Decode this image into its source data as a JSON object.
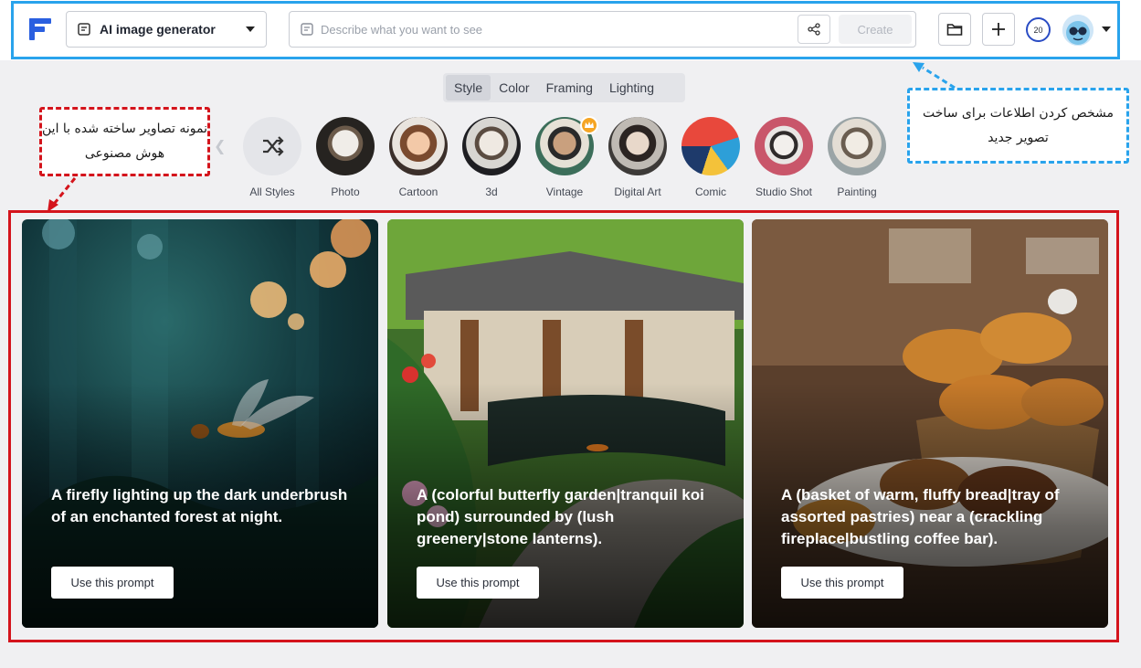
{
  "header": {
    "generator_label": "AI image generator",
    "prompt_placeholder": "Describe what you want to see",
    "create_label": "Create",
    "credits": "20"
  },
  "tabs": [
    {
      "label": "Style",
      "active": true
    },
    {
      "label": "Color",
      "active": false
    },
    {
      "label": "Framing",
      "active": false
    },
    {
      "label": "Lighting",
      "active": false
    }
  ],
  "styles": [
    {
      "label": "All Styles",
      "icon": "shuffle-icon"
    },
    {
      "label": "Photo"
    },
    {
      "label": "Cartoon"
    },
    {
      "label": "3d"
    },
    {
      "label": "Vintage",
      "badge": "crown-icon"
    },
    {
      "label": "Digital Art"
    },
    {
      "label": "Comic"
    },
    {
      "label": "Studio Shot"
    },
    {
      "label": "Painting"
    }
  ],
  "callouts": {
    "gallery_note": "نمونه تصاویر ساخته شده با این هوش مصنوعی",
    "header_note": "مشخص کردن اطلاعات برای ساخت تصویر جدید"
  },
  "gallery": [
    {
      "caption": "A firefly lighting up the dark underbrush of an enchanted forest at night.",
      "button": "Use this prompt"
    },
    {
      "caption": "A (colorful butterfly garden|tranquil koi pond) surrounded by (lush greenery|stone lanterns).",
      "button": "Use this prompt"
    },
    {
      "caption": "A (basket of warm, fluffy bread|tray of assorted pastries) near a (crackling fireplace|bustling coffee bar).",
      "button": "Use this prompt"
    }
  ],
  "colors": {
    "header_outline": "#29a3ec",
    "gallery_outline": "#d4141c",
    "brand": "#2a4cc4"
  }
}
